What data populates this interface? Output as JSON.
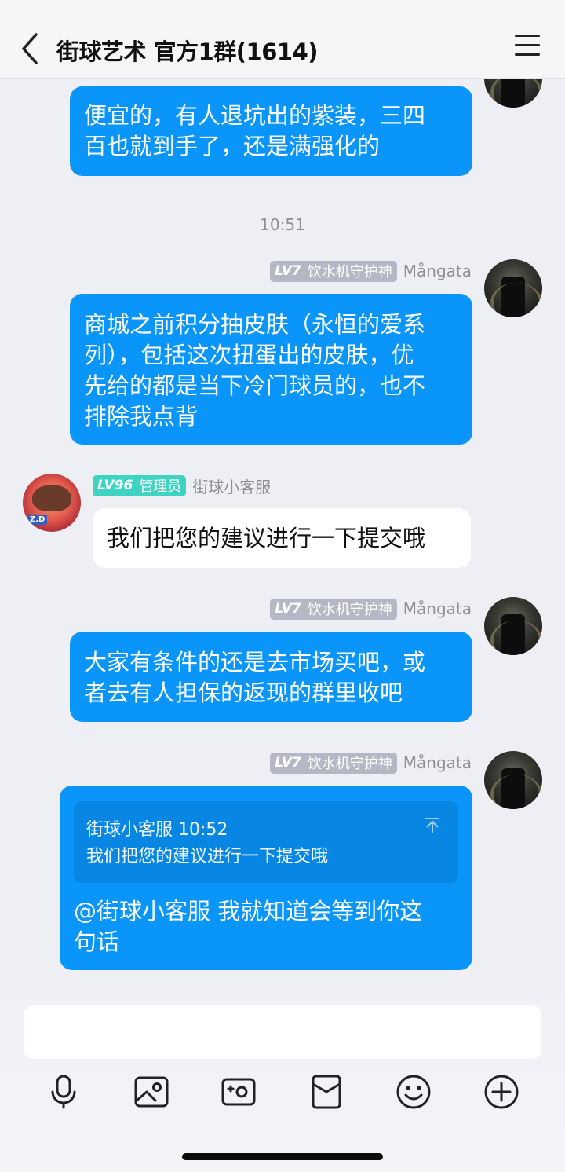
{
  "header": {
    "title": "街球艺术 官方1群(1614)"
  },
  "chat": {
    "time_label": "10:51",
    "messages": [
      {
        "lines": [
          "便宜的，有人退坑出的紫装，三四",
          "百也就到手了，还是满强化的"
        ]
      },
      {
        "badge_lv": "LV7",
        "badge_title": "饮水机守护神",
        "sender": "Mångata",
        "lines": [
          "商城之前积分抽皮肤（永恒的爱系",
          "列），包括这次扭蛋出的皮肤，优",
          "先给的都是当下冷门球员的，也不",
          "排除我点背"
        ]
      },
      {
        "badge_lv": "LV96",
        "badge_title": "管理员",
        "sender": "街球小客服",
        "lines": [
          "我们把您的建议进行一下提交哦"
        ]
      },
      {
        "badge_lv": "LV7",
        "badge_title": "饮水机守护神",
        "sender": "Mångata",
        "lines": [
          "大家有条件的还是去市场买吧，或",
          "者去有人担保的返现的群里收吧"
        ]
      },
      {
        "badge_lv": "LV7",
        "badge_title": "饮水机守护神",
        "sender": "Mångata",
        "quote_meta": "街球小客服 10:52",
        "quote_text": "我们把您的建议进行一下提交哦",
        "lines": [
          "@街球小客服 我就知道会等到你这",
          "句话"
        ]
      }
    ]
  },
  "toolbar": {
    "icons": [
      "microphone-icon",
      "photo-icon",
      "camera-icon",
      "red-packet-icon",
      "emoji-icon",
      "plus-icon"
    ]
  },
  "colors": {
    "bubble_blue": "#0a95fb",
    "quote_blue": "#0786e3",
    "badge_gray": "#b5b8c4",
    "badge_teal": "#3ed3c2",
    "background": "#eeeff4"
  }
}
